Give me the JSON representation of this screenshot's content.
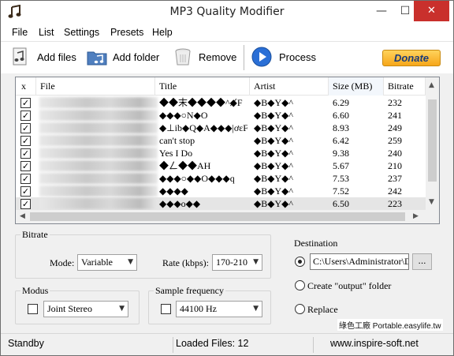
{
  "window": {
    "title": "MP3 Quality Modifier",
    "minimize": "—",
    "maximize": "☐",
    "close": "✕"
  },
  "menu": [
    "File",
    "List",
    "Settings",
    "Presets",
    "Help"
  ],
  "toolbar": {
    "add_files": "Add files",
    "add_folder": "Add folder",
    "remove": "Remove",
    "process": "Process",
    "donate": "Donate"
  },
  "list": {
    "columns": [
      "x",
      "File",
      "Title",
      "Artist",
      "Size  (MB)",
      "Bitrate"
    ],
    "rows": [
      {
        "checked": true,
        "title": "◆◆末◆◆◆◆^◆̸F",
        "artist": "◆B◆Y◆^",
        "size": "6.29",
        "bitrate": "232"
      },
      {
        "checked": true,
        "title": "◆◆◆○N◆O",
        "artist": "◆B◆Y◆^",
        "size": "6.60",
        "bitrate": "241"
      },
      {
        "checked": true,
        "title": "◆⊥ib◆Q◆A◆◆◆|ơɛF",
        "artist": "◆B◆Y◆^",
        "size": "8.93",
        "bitrate": "249"
      },
      {
        "checked": true,
        "title": "can't stop",
        "artist": "◆B◆Y◆^",
        "size": "6.42",
        "bitrate": "259"
      },
      {
        "checked": true,
        "title": "Yes I Do",
        "artist": "◆B◆Y◆^",
        "size": "9.38",
        "bitrate": "240"
      },
      {
        "checked": true,
        "title": "◆ㄥ◆◆AH",
        "artist": "◆B◆Y◆^",
        "size": "5.67",
        "bitrate": "210"
      },
      {
        "checked": true,
        "title": "◆◆◆○◆◆O◆◆◆q",
        "artist": "◆B◆Y◆^",
        "size": "7.53",
        "bitrate": "237"
      },
      {
        "checked": true,
        "title": "◆◆◆◆",
        "artist": "◆B◆Y◆^",
        "size": "7.52",
        "bitrate": "242"
      },
      {
        "checked": true,
        "title": "◆◆◆o◆◆",
        "artist": "◆B◆Y◆^",
        "size": "6.50",
        "bitrate": "223"
      }
    ]
  },
  "bitrate": {
    "legend": "Bitrate",
    "mode_label": "Mode:",
    "mode_value": "Variable",
    "rate_label": "Rate (kbps):",
    "rate_value": "170-210"
  },
  "modus": {
    "legend": "Modus",
    "value": "Joint Stereo"
  },
  "sample": {
    "legend": "Sample frequency",
    "value": "44100 Hz"
  },
  "destination": {
    "legend": "Destination",
    "path": "C:\\Users\\Administrator\\D",
    "browse": "...",
    "create_output": "Create \"output\" folder",
    "replace": "Replace",
    "selected": "path"
  },
  "status": {
    "state": "Standby",
    "loaded": "Loaded Files: 12",
    "website": "www.inspire-soft.net"
  },
  "watermark": "綠色工廠 Portable.easylife.tw"
}
